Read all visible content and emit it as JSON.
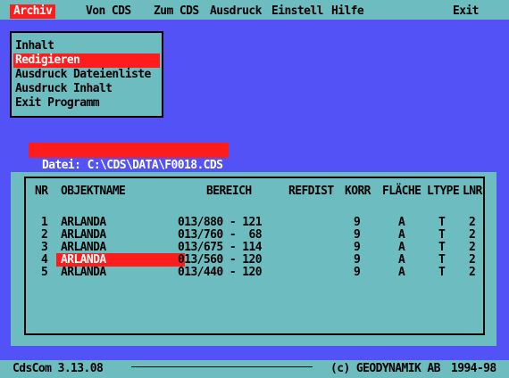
{
  "menu": {
    "items": [
      "Archiv",
      "Von CDS",
      "Zum CDS",
      "Ausdruck",
      "Einstell",
      "Hilfe"
    ],
    "exit": "Exit"
  },
  "dropdown": {
    "items": [
      "Inhalt",
      "Redigieren",
      "Ausdruck Dateienliste",
      "Ausdruck Inhalt",
      "Exit Programm"
    ]
  },
  "file_label": "Datei: C:\\CDS\\DATA\\F0018.CDS",
  "table": {
    "headers": [
      "NR",
      "OBJEKTNAME",
      "BEREICH",
      "REFDIST",
      "KORR",
      "FLÄCHE",
      "LTYPE",
      "LNR"
    ],
    "rows": [
      {
        "nr": "1",
        "name": "ARLANDA",
        "bereich": "013/880 - 121",
        "refdist": "",
        "korr": "9",
        "flache": "A",
        "ltype": "T",
        "lnr": "2"
      },
      {
        "nr": "2",
        "name": "ARLANDA",
        "bereich": "013/760 -  68",
        "refdist": "",
        "korr": "9",
        "flache": "A",
        "ltype": "T",
        "lnr": "2"
      },
      {
        "nr": "3",
        "name": "ARLANDA",
        "bereich": "013/675 - 114",
        "refdist": "",
        "korr": "9",
        "flache": "A",
        "ltype": "T",
        "lnr": "2"
      },
      {
        "nr": "4",
        "name": "ARLANDA",
        "bereich": "013/560 - 120",
        "refdist": "",
        "korr": "9",
        "flache": "A",
        "ltype": "T",
        "lnr": "2"
      },
      {
        "nr": "5",
        "name": "ARLANDA",
        "bereich": "013/440 - 120",
        "refdist": "",
        "korr": "9",
        "flache": "A",
        "ltype": "T",
        "lnr": "2"
      }
    ]
  },
  "status": {
    "version": "CdsCom 3.13.08",
    "copyright": "(c) GEODYNAMIK AB",
    "years": "1994-98"
  }
}
